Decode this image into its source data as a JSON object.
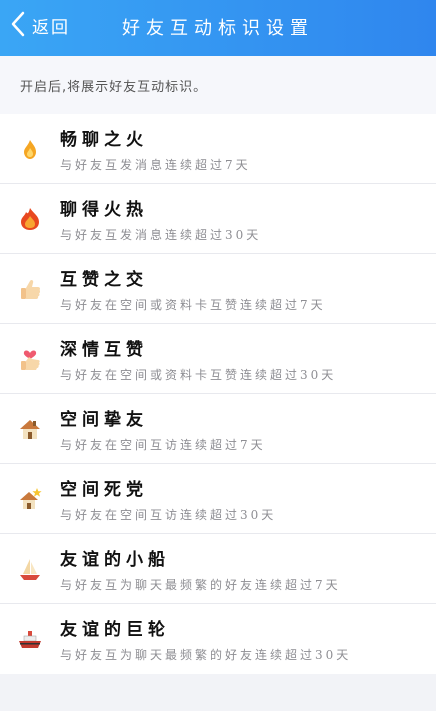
{
  "header": {
    "back_label": "返回",
    "title": "好友互动标识设置"
  },
  "notice": "开启后,将展示好友互动标识。",
  "items": [
    {
      "name": "畅聊之火",
      "desc": "与好友互发消息连续超过7天",
      "icon": "small-flame-icon"
    },
    {
      "name": "聊得火热",
      "desc": "与好友互发消息连续超过30天",
      "icon": "big-flame-icon"
    },
    {
      "name": "互赞之交",
      "desc": "与好友在空间或资料卡互赞连续超过7天",
      "icon": "thumbs-up-icon"
    },
    {
      "name": "深情互赞",
      "desc": "与好友在空间或资料卡互赞连续超过30天",
      "icon": "heart-thumbs-up-icon"
    },
    {
      "name": "空间挚友",
      "desc": "与好友在空间互访连续超过7天",
      "icon": "house-icon"
    },
    {
      "name": "空间死党",
      "desc": "与好友在空间互访连续超过30天",
      "icon": "house-star-icon"
    },
    {
      "name": "友谊的小船",
      "desc": "与好友互为聊天最频繁的好友连续超过7天",
      "icon": "sailboat-icon"
    },
    {
      "name": "友谊的巨轮",
      "desc": "与好友互为聊天最频繁的好友连续超过30天",
      "icon": "ship-icon"
    }
  ]
}
